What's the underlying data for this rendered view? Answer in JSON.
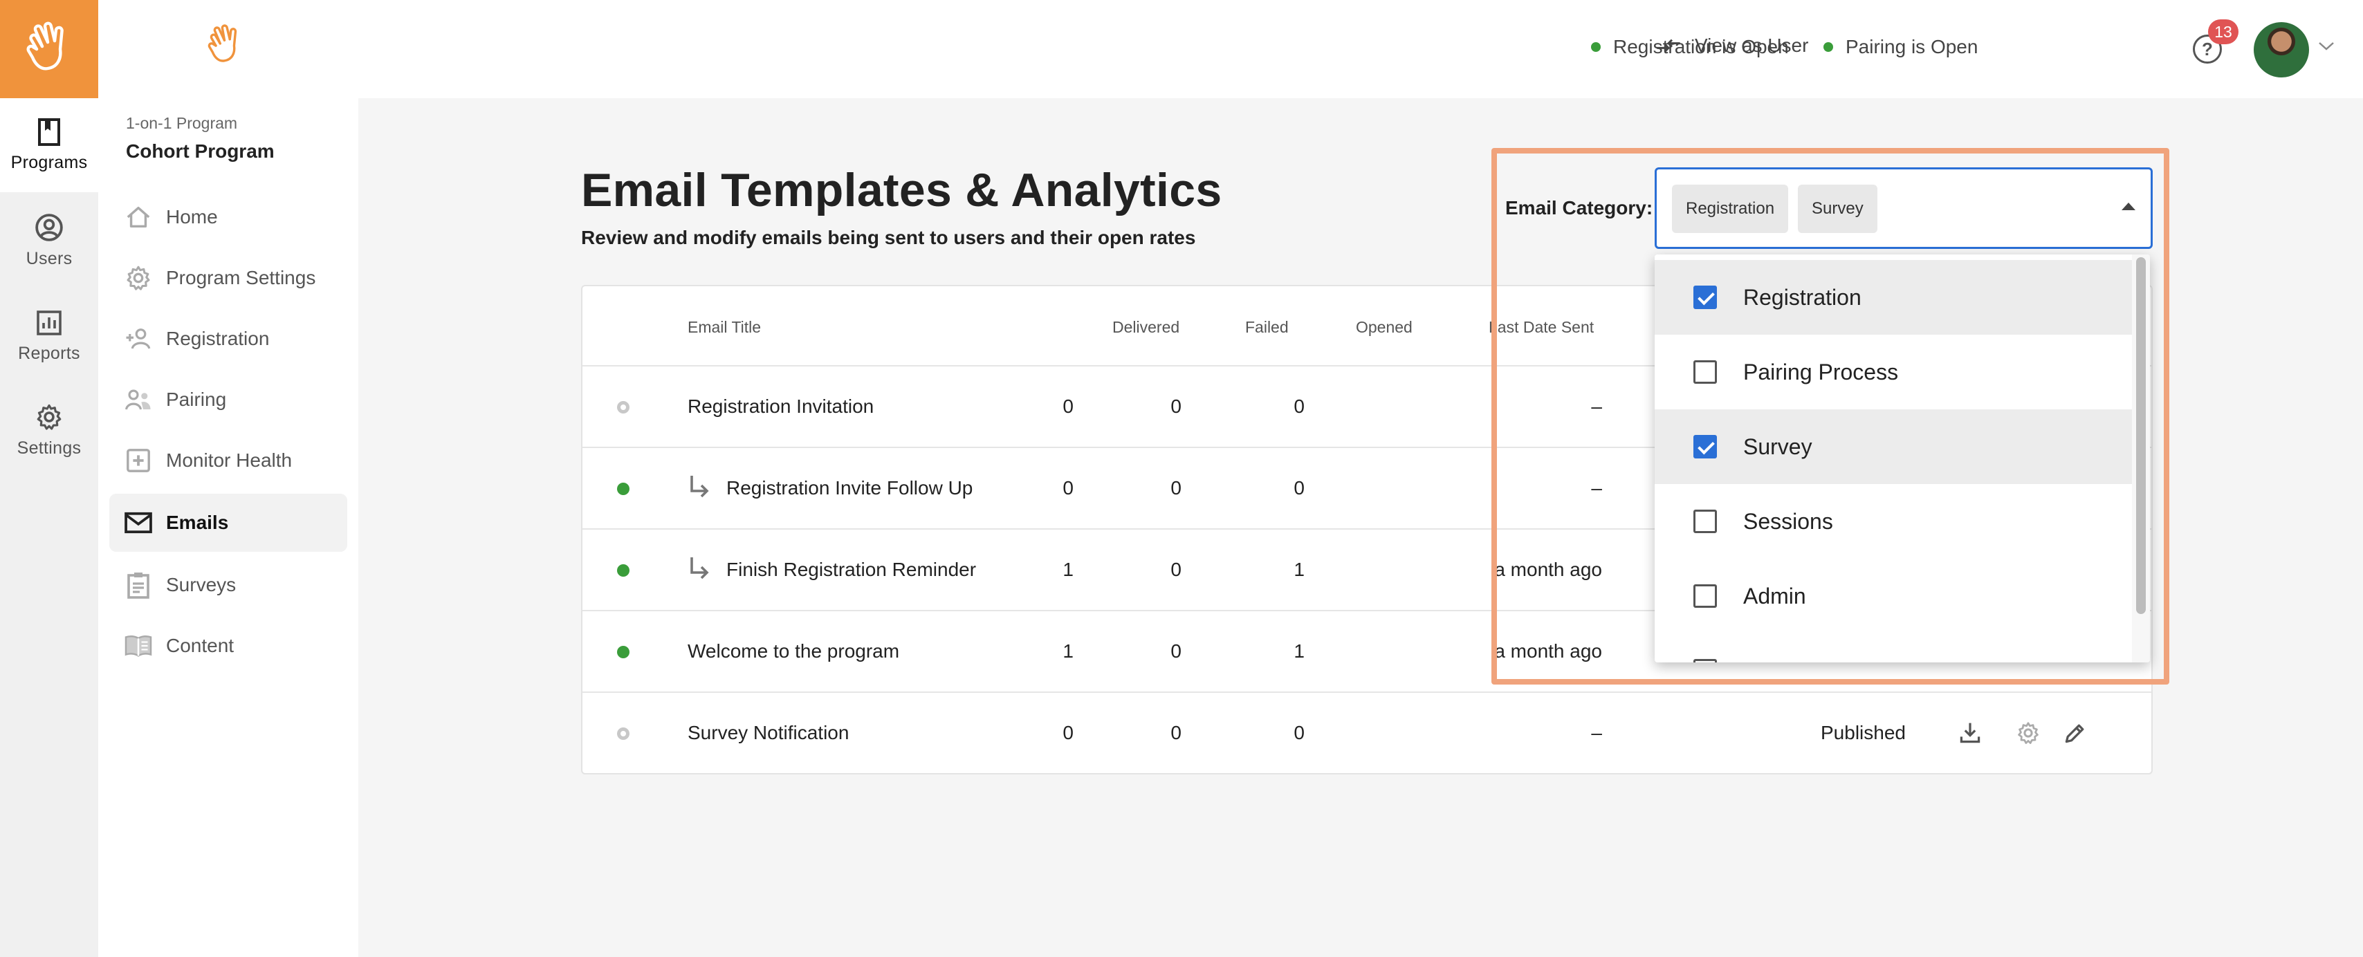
{
  "rail": {
    "items": [
      {
        "label": "Programs",
        "icon": "book-icon"
      },
      {
        "label": "Users",
        "icon": "user-circle-icon"
      },
      {
        "label": "Reports",
        "icon": "bar-chart-icon"
      },
      {
        "label": "Settings",
        "icon": "gear-icon"
      }
    ]
  },
  "sidebar": {
    "program_subtitle": "1-on-1 Program",
    "program_name": "Cohort Program",
    "items": [
      {
        "label": "Home",
        "icon": "home-icon"
      },
      {
        "label": "Program Settings",
        "icon": "gear-icon"
      },
      {
        "label": "Registration",
        "icon": "add-user-icon"
      },
      {
        "label": "Pairing",
        "icon": "users-icon"
      },
      {
        "label": "Monitor Health",
        "icon": "health-plus-icon"
      },
      {
        "label": "Emails",
        "icon": "envelope-icon"
      },
      {
        "label": "Surveys",
        "icon": "clipboard-icon"
      },
      {
        "label": "Content",
        "icon": "open-book-icon"
      }
    ]
  },
  "topbar": {
    "registration_status": "Registration is Open",
    "pairing_status": "Pairing is Open",
    "view_as_user": "View as User",
    "help_symbol": "?",
    "notification_count": "13"
  },
  "page": {
    "title": "Email Templates & Analytics",
    "subtitle": "Review and modify emails being sent to users and their open rates"
  },
  "table": {
    "headers": {
      "title": "Email Title",
      "delivered": "Delivered",
      "failed": "Failed",
      "opened": "Opened",
      "last_sent": "Last Date Sent"
    },
    "rows": [
      {
        "title": "Registration Invitation",
        "delivered": "0",
        "failed": "0",
        "opened": "0",
        "last_sent": "–",
        "status": "",
        "nested": false,
        "active": false
      },
      {
        "title": "Registration Invite Follow Up",
        "delivered": "0",
        "failed": "0",
        "opened": "0",
        "last_sent": "–",
        "status": "",
        "nested": true,
        "active": true
      },
      {
        "title": "Finish Registration Reminder",
        "delivered": "1",
        "failed": "0",
        "opened": "1",
        "last_sent": "a month ago",
        "status": "",
        "nested": true,
        "active": true
      },
      {
        "title": "Welcome to the program",
        "delivered": "1",
        "failed": "0",
        "opened": "1",
        "last_sent": "a month ago",
        "status": "",
        "nested": false,
        "active": true
      },
      {
        "title": "Survey Notification",
        "delivered": "0",
        "failed": "0",
        "opened": "0",
        "last_sent": "–",
        "status": "Published",
        "nested": false,
        "active": false
      }
    ]
  },
  "filter": {
    "label": "Email Category:",
    "selected_chips": [
      "Registration",
      "Survey"
    ],
    "options": [
      {
        "label": "Registration",
        "checked": true
      },
      {
        "label": "Pairing Process",
        "checked": false
      },
      {
        "label": "Survey",
        "checked": true
      },
      {
        "label": "Sessions",
        "checked": false
      },
      {
        "label": "Admin",
        "checked": false
      }
    ]
  },
  "colors": {
    "brand_orange": "#f0933c",
    "highlight": "#f0a37c",
    "accent_blue": "#2a6fd6",
    "status_green": "#3a9d3a",
    "badge_red": "#e05454"
  }
}
